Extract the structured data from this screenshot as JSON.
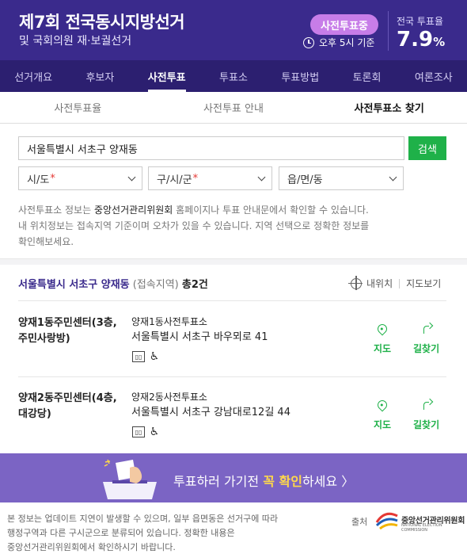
{
  "header": {
    "title": "제7회 전국동시지방선거",
    "subtitle": "및 국회의원 재·보궐선거",
    "status_pill": "사전투표중",
    "time_text": "오후 5시 기준",
    "rate_label": "전국 투표율",
    "rate_value": "7.9",
    "rate_unit": "%"
  },
  "nav": {
    "items": [
      "선거개요",
      "후보자",
      "사전투표",
      "투표소",
      "투표방법",
      "토론회",
      "여론조사"
    ],
    "active_index": 2
  },
  "subtabs": {
    "items": [
      "사전투표율",
      "사전투표 안내",
      "사전투표소 찾기"
    ],
    "active_index": 2
  },
  "search": {
    "value": "서울특별시 서초구 양재동",
    "button": "검색"
  },
  "selects": [
    {
      "label": "시/도",
      "required": "*"
    },
    {
      "label": "구/시/군",
      "required": "*"
    },
    {
      "label": "읍/면/동",
      "required": ""
    }
  ],
  "info": {
    "line1_pre": "사전투표소 정보는 ",
    "line1_org": "중앙선거관리위원회",
    "line1_post": " 홈페이지나 투표 안내문에서 확인할 수 있습니다.",
    "line2": "내 위치정보는 접속지역 기준이며 오차가 있을 수 있습니다. 지역 선택으로 정확한 정보를",
    "line3": "확인해보세요."
  },
  "results": {
    "location": "서울특별시 서초구 양재동",
    "location_note": "(접속지역)",
    "count_text": "총2건",
    "my_location": "내위치",
    "map_view": "지도보기",
    "items": [
      {
        "name_line1": "양재1동주민센터(3층,",
        "name_line2": "주민사랑방)",
        "station": "양재1동사전투표소",
        "address": "서울특별시 서초구 바우뫼로 41",
        "map_label": "지도",
        "route_label": "길찾기"
      },
      {
        "name_line1": "양재2동주민센터(4층,",
        "name_line2": "대강당)",
        "station": "양재2동사전투표소",
        "address": "서울특별시 서초구 강남대로12길 44",
        "map_label": "지도",
        "route_label": "길찾기"
      }
    ],
    "icons": [
      "elevator-icon",
      "wheelchair-icon"
    ]
  },
  "banner": {
    "pre": "투표하러 가기전 ",
    "highlight": "꼭 확인",
    "post": "하세요 〉"
  },
  "footer": {
    "line1": "본 정보는 업데이트 지연이 발생할 수 있으며, 일부 읍면동은 선거구에 따라",
    "line2": "행정구역과 다른 구시군으로 분류되어 있습니다. 정확한 내용은",
    "line3": "중앙선거관리위원회에서 확인하시기 바랍니다.",
    "source_label": "출처",
    "org_name": "중앙선거관리위원회",
    "org_en": "NATIONAL ELECTION COMMISSION"
  },
  "colors": {
    "header_bg": "#3a2a8c",
    "nav_bg": "#2c1f70",
    "accent_green": "#1fb149",
    "banner_bg": "#7b64c4",
    "highlight_yellow": "#ffd84a"
  }
}
